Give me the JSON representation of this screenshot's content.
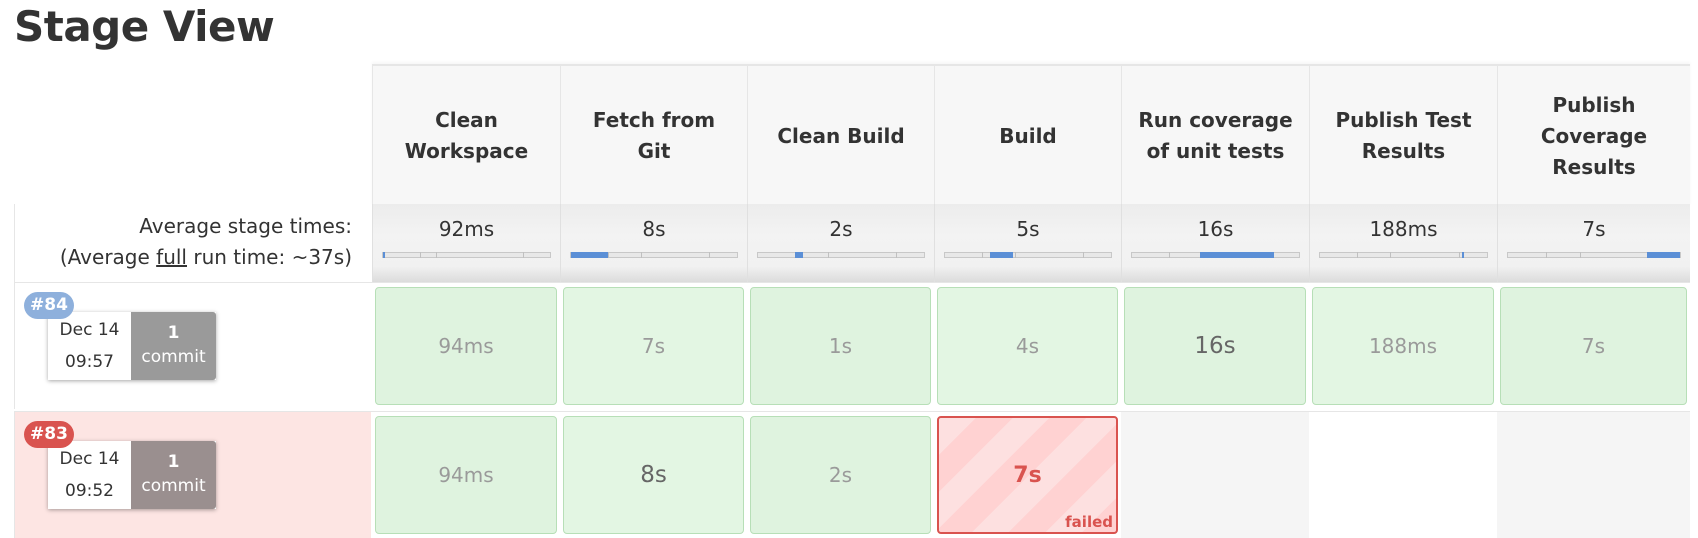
{
  "page": {
    "title": "Stage View"
  },
  "stages": [
    {
      "label": "Clean Workspace",
      "lines": [
        "Clean",
        "Workspace"
      ],
      "avg": "92ms"
    },
    {
      "label": "Fetch from Git",
      "lines": [
        "Fetch from",
        "Git"
      ],
      "avg": "8s"
    },
    {
      "label": "Clean Build",
      "lines": [
        "Clean Build"
      ],
      "avg": "2s"
    },
    {
      "label": "Build",
      "lines": [
        "Build"
      ],
      "avg": "5s"
    },
    {
      "label": "Run coverage of unit tests",
      "lines": [
        "Run coverage",
        "of unit tests"
      ],
      "avg": "16s"
    },
    {
      "label": "Publish Test Results",
      "lines": [
        "Publish Test",
        "Results"
      ],
      "avg": "188ms"
    },
    {
      "label": "Publish Coverage Results",
      "lines": [
        "Publish",
        "Coverage",
        "Results"
      ],
      "avg": "7s"
    }
  ],
  "averages": {
    "label": "Average stage times:",
    "full_prefix": "(Average ",
    "full_word": "full",
    "full_suffix": " run time: ~37s)"
  },
  "runs": [
    {
      "id": "#84",
      "status": "success",
      "date": "Dec 14",
      "time": "09:57",
      "commit_count": "1",
      "commit_word": "commit",
      "cells": [
        {
          "value": "94ms",
          "status": "success"
        },
        {
          "value": "7s",
          "status": "success"
        },
        {
          "value": "1s",
          "status": "success"
        },
        {
          "value": "4s",
          "status": "success"
        },
        {
          "value": "16s",
          "status": "success"
        },
        {
          "value": "188ms",
          "status": "success"
        },
        {
          "value": "7s",
          "status": "success"
        }
      ]
    },
    {
      "id": "#83",
      "status": "failed",
      "date": "Dec 14",
      "time": "09:52",
      "commit_count": "1",
      "commit_word": "commit",
      "cells": [
        {
          "value": "94ms",
          "status": "success"
        },
        {
          "value": "8s",
          "status": "success"
        },
        {
          "value": "2s",
          "status": "success"
        },
        {
          "value": "7s",
          "status": "failed",
          "status_label": "failed"
        },
        null,
        null,
        null
      ]
    }
  ],
  "colors": {
    "success_badge": "#8eb0dc",
    "failed_badge": "#d9534f",
    "commit_success": "#9a9a9a",
    "commit_failed": "#9a8f8f",
    "failed_row_bg": "#fde5e3",
    "bar_fill": "#5b8fd6"
  },
  "avg_bar_fill": [
    {
      "start": 0.0,
      "end": 0.01
    },
    {
      "start": 0.0,
      "end": 0.22
    },
    {
      "start": 0.22,
      "end": 0.27
    },
    {
      "start": 0.27,
      "end": 0.41
    },
    {
      "start": 0.41,
      "end": 0.85
    },
    {
      "start": 0.85,
      "end": 0.86
    },
    {
      "start": 0.81,
      "end": 1.0
    }
  ]
}
